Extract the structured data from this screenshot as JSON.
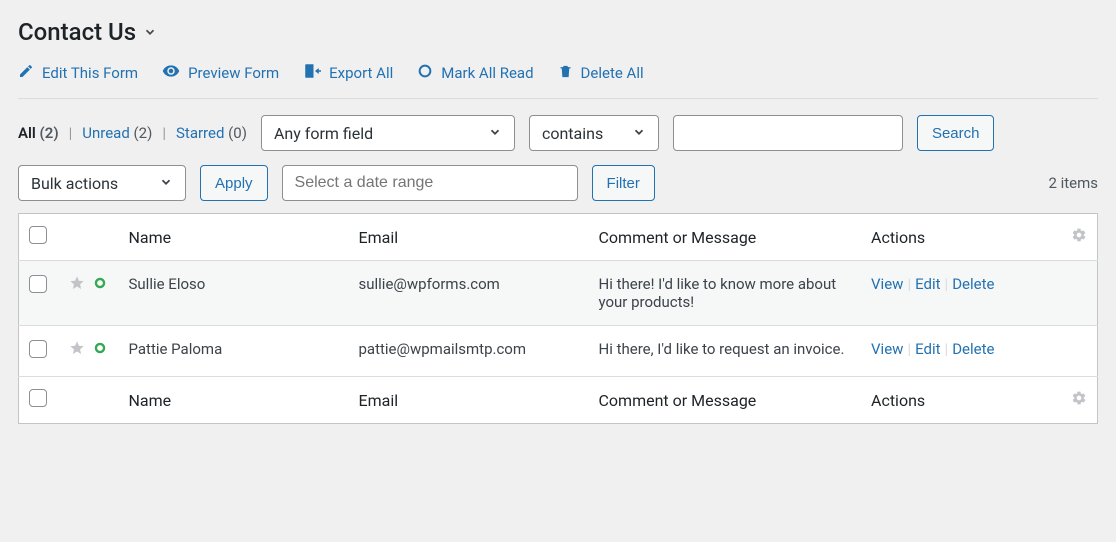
{
  "header": {
    "title": "Contact Us"
  },
  "toolbar": {
    "edit_label": "Edit This Form",
    "preview_label": "Preview Form",
    "export_label": "Export All",
    "mark_read_label": "Mark All Read",
    "delete_all_label": "Delete All"
  },
  "status_filters": {
    "all": {
      "label": "All",
      "count": "(2)"
    },
    "unread": {
      "label": "Unread",
      "count": "(2)"
    },
    "starred": {
      "label": "Starred",
      "count": "(0)"
    }
  },
  "search": {
    "field_placeholder": "Any form field",
    "condition": "contains",
    "value": "",
    "button": "Search"
  },
  "bulk": {
    "label": "Bulk actions",
    "apply": "Apply"
  },
  "date_filter": {
    "placeholder": "Select a date range",
    "button": "Filter"
  },
  "pagination": {
    "items_text": "2 items"
  },
  "columns": {
    "name": "Name",
    "email": "Email",
    "comment": "Comment or Message",
    "actions": "Actions"
  },
  "row_actions": {
    "view": "View",
    "edit": "Edit",
    "delete": "Delete"
  },
  "entries": [
    {
      "name": "Sullie Eloso",
      "email": "sullie@wpforms.com",
      "comment": "Hi there! I'd like to know more about your products!"
    },
    {
      "name": "Pattie Paloma",
      "email": "pattie@wpmailsmtp.com",
      "comment": "Hi there, I'd like to request an invoice."
    }
  ]
}
